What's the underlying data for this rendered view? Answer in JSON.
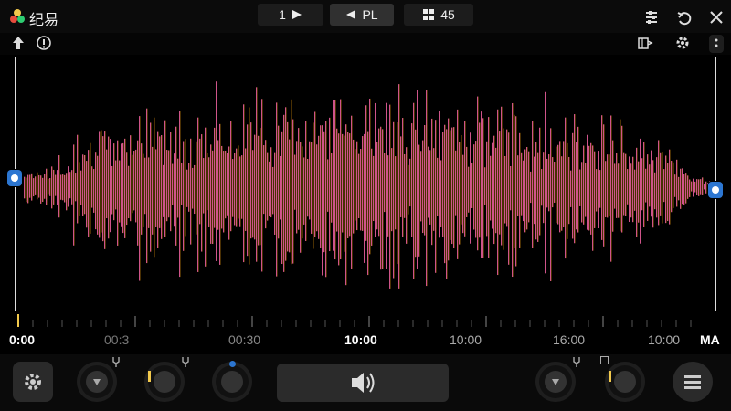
{
  "app": {
    "title": "纪易"
  },
  "tabs": {
    "tab1_label": "1",
    "tab2_label": "PL",
    "tab3_label": "45"
  },
  "timeline": {
    "labels": [
      "0:00",
      "00:3",
      "00:30",
      "10:00",
      "10:00",
      "16:00",
      "10:00",
      "MA"
    ]
  },
  "icons": {
    "logo": "app-logo-icon",
    "tab1": "play-icon",
    "tab2": "rewind-icon",
    "tab3": "grid-icon",
    "settings": "sliders-icon",
    "undo": "undo-icon",
    "close": "close-icon",
    "up": "arrow-up-icon",
    "info": "info-icon",
    "book": "book-icon",
    "gear": "gear-icon",
    "more": "more-icon",
    "settings_btn": "gear-icon",
    "speaker": "speaker-icon",
    "menu": "menu-icon"
  },
  "colors": {
    "accent": "#2c76d1",
    "indicator": "#f2c94c"
  }
}
